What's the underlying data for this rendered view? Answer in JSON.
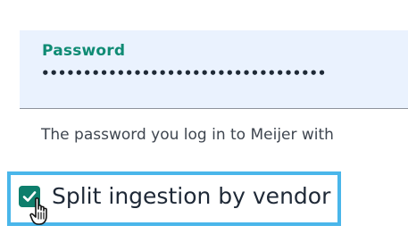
{
  "password_field": {
    "label": "Password",
    "masked_value": "••••••••••••••••••••••••••••••••••"
  },
  "help_text": "The password you log in to Meijer with",
  "split_option": {
    "label": "Split ingestion by vendor",
    "checked": true
  },
  "colors": {
    "field_background": "#eaf2fe",
    "label_accent": "#0f8b74",
    "checkbox_fill": "#0e7e6c",
    "highlight_border": "#4ab6ea"
  },
  "icons": {
    "checkbox_check": "check-icon",
    "cursor": "hand-pointer-icon"
  }
}
